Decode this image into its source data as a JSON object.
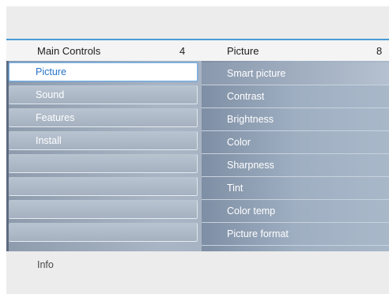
{
  "header": {
    "left_title": "Main Controls",
    "left_count": "4",
    "right_title": "Picture",
    "right_count": "8"
  },
  "main_controls": {
    "selected_index": 0,
    "items": [
      "Picture",
      "Sound",
      "Features",
      "Install",
      "",
      "",
      "",
      ""
    ]
  },
  "picture_menu": {
    "items": [
      "Smart picture",
      "Contrast",
      "Brightness",
      "Color",
      "Sharpness",
      "Tint",
      "Color temp",
      "Picture format"
    ]
  },
  "footer": {
    "info_label": "Info"
  },
  "colors": {
    "accent_blue": "#4a9bd6",
    "selected_text": "#2874c8",
    "panel_gray_blue": "#a5b1c0"
  }
}
